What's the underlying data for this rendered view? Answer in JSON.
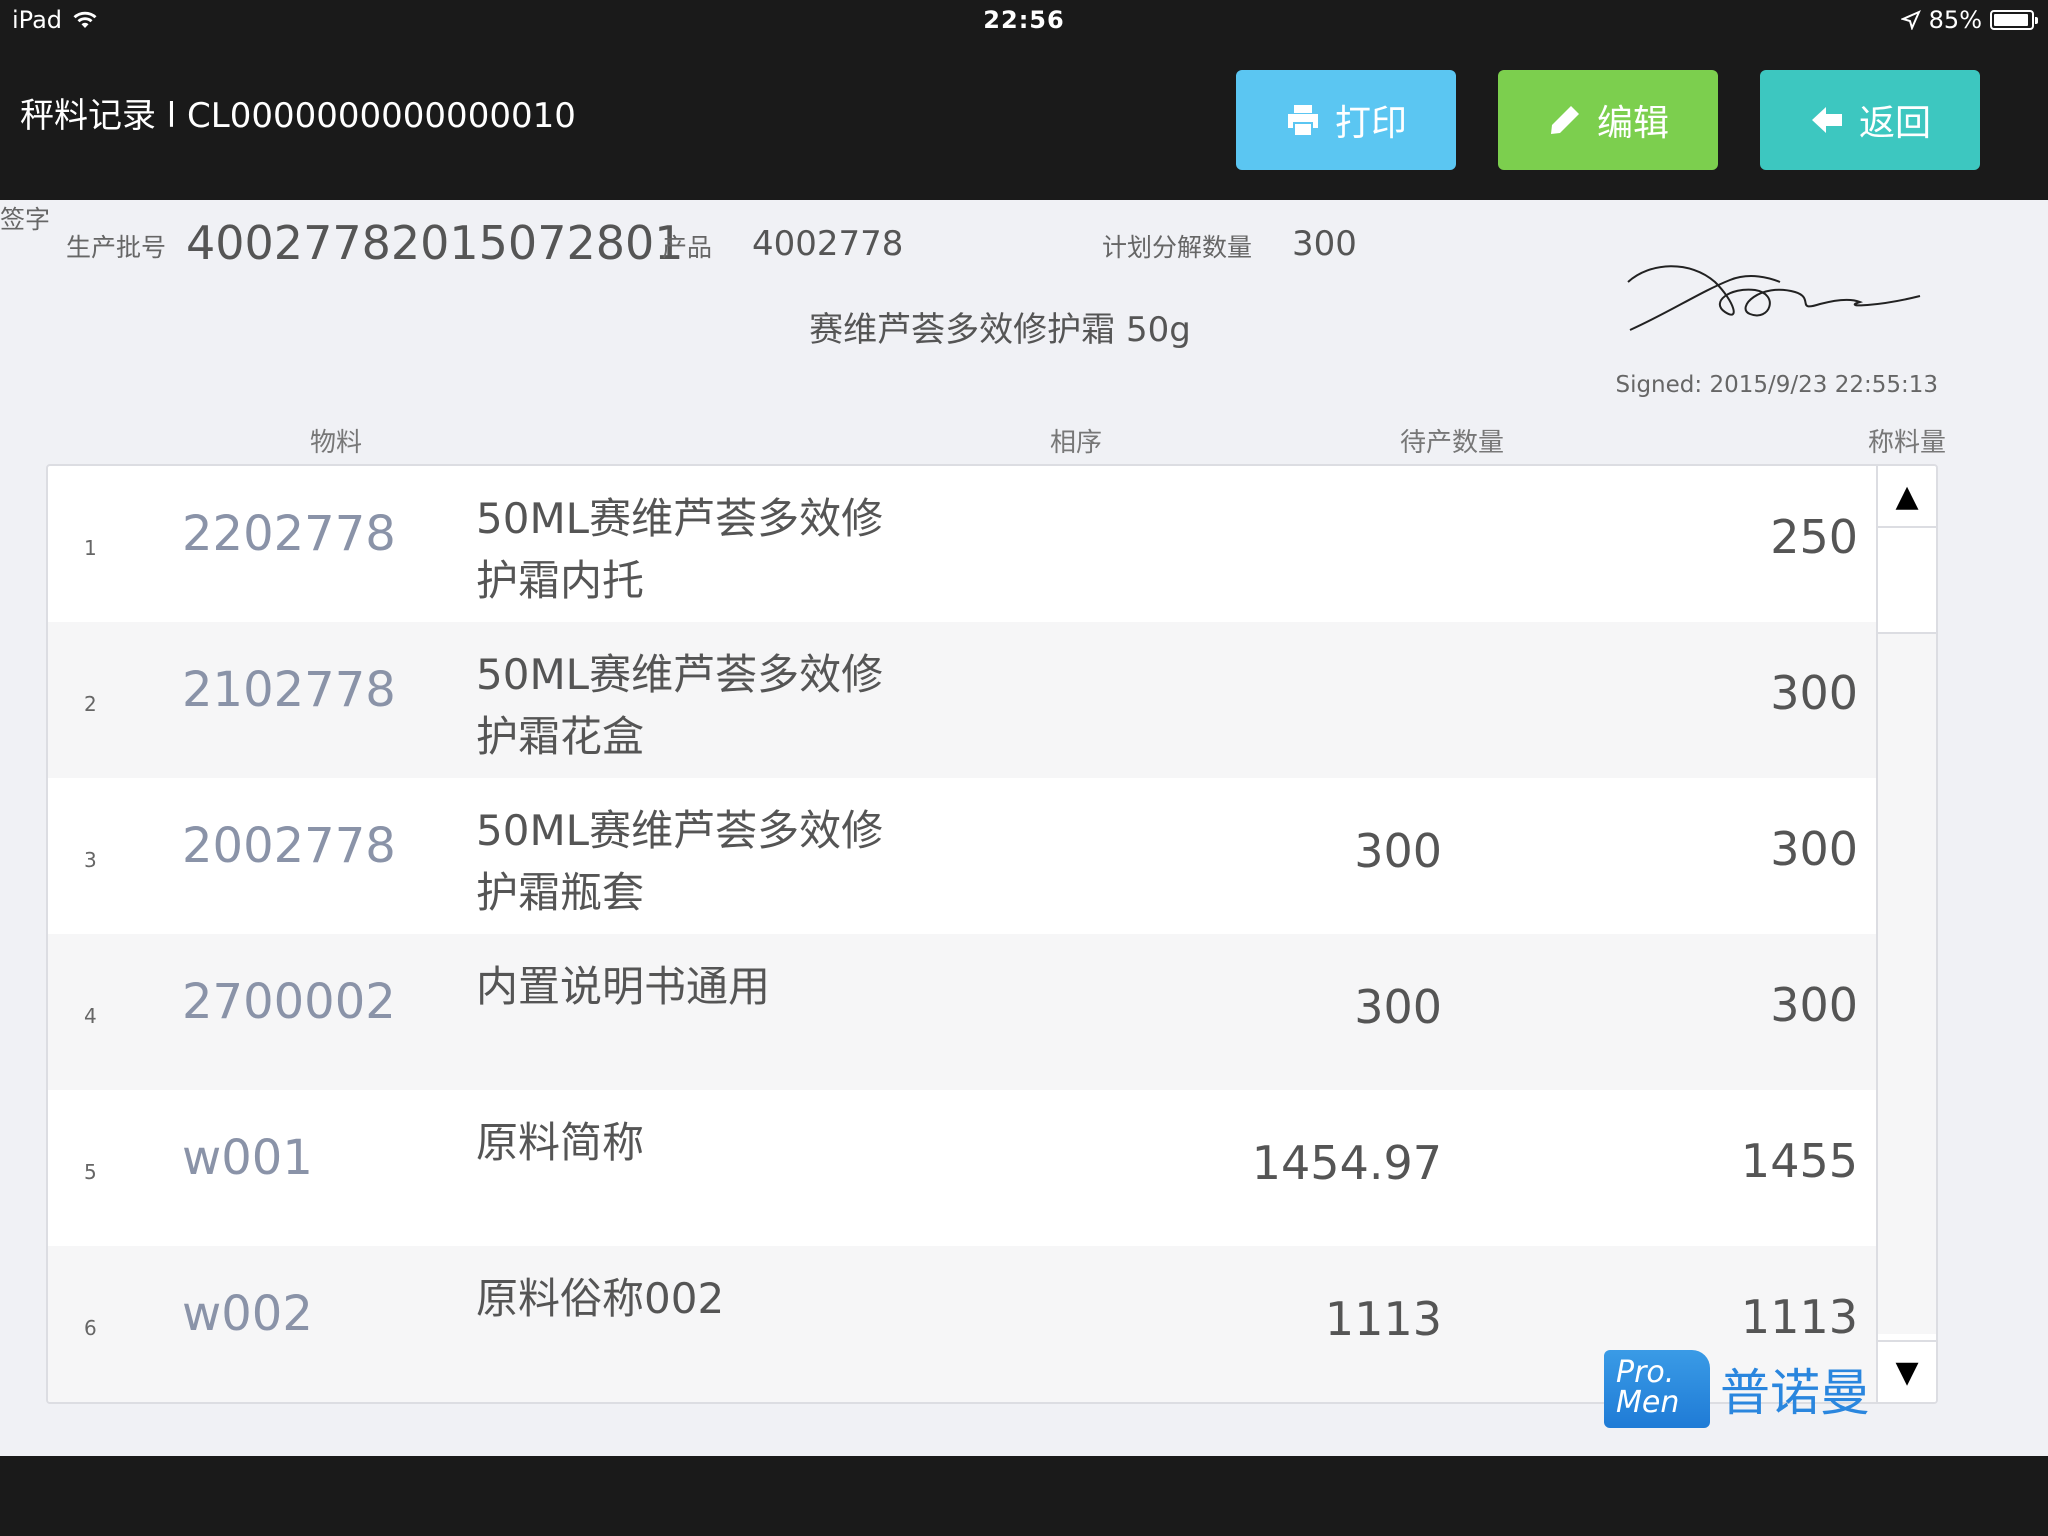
{
  "status_bar": {
    "device": "iPad",
    "time": "22:56",
    "battery": "85%"
  },
  "header": {
    "title": "秤料记录 l CL0000000000000010",
    "print_label": "打印",
    "edit_label": "编辑",
    "back_label": "返回"
  },
  "info": {
    "batch_label": "生产批号",
    "batch_value": "40027782015072801",
    "product_label": "产品",
    "product_value": "4002778",
    "plan_label": "计划分解数量",
    "plan_value": "300",
    "sign_label": "签字",
    "product_name": "赛维芦荟多效修护霜 50g",
    "signed": "Signed: 2015/9/23 22:55:13"
  },
  "columns": {
    "material": "物料",
    "seq": "相序",
    "pending": "待产数量",
    "weigh": "称料量"
  },
  "rows": [
    {
      "idx": "1",
      "code": "2202778",
      "name": "50ML赛维芦荟多效修护霜内托",
      "pending": "",
      "weigh": "250"
    },
    {
      "idx": "2",
      "code": "2102778",
      "name": "50ML赛维芦荟多效修护霜花盒",
      "pending": "",
      "weigh": "300"
    },
    {
      "idx": "3",
      "code": "2002778",
      "name": "50ML赛维芦荟多效修护霜瓶套",
      "pending": "300",
      "weigh": "300"
    },
    {
      "idx": "4",
      "code": "2700002",
      "name": "内置说明书通用",
      "pending": "300",
      "weigh": "300"
    },
    {
      "idx": "5",
      "code": "w001",
      "name": "原料简称",
      "pending": "1454.97",
      "weigh": "1455"
    },
    {
      "idx": "6",
      "code": "w002",
      "name": "原料俗称002",
      "pending": "1113",
      "weigh": "1113"
    }
  ],
  "scroll": {
    "up": "▲",
    "down": "▼"
  },
  "logo": {
    "mark_line1": "Pro.",
    "mark_line2": "Men",
    "text": "普诺曼"
  },
  "colors": {
    "print": "#5bc6f2",
    "edit": "#7ccf4e",
    "back": "#3dc7c0",
    "header_bg": "#1a1a1a"
  }
}
